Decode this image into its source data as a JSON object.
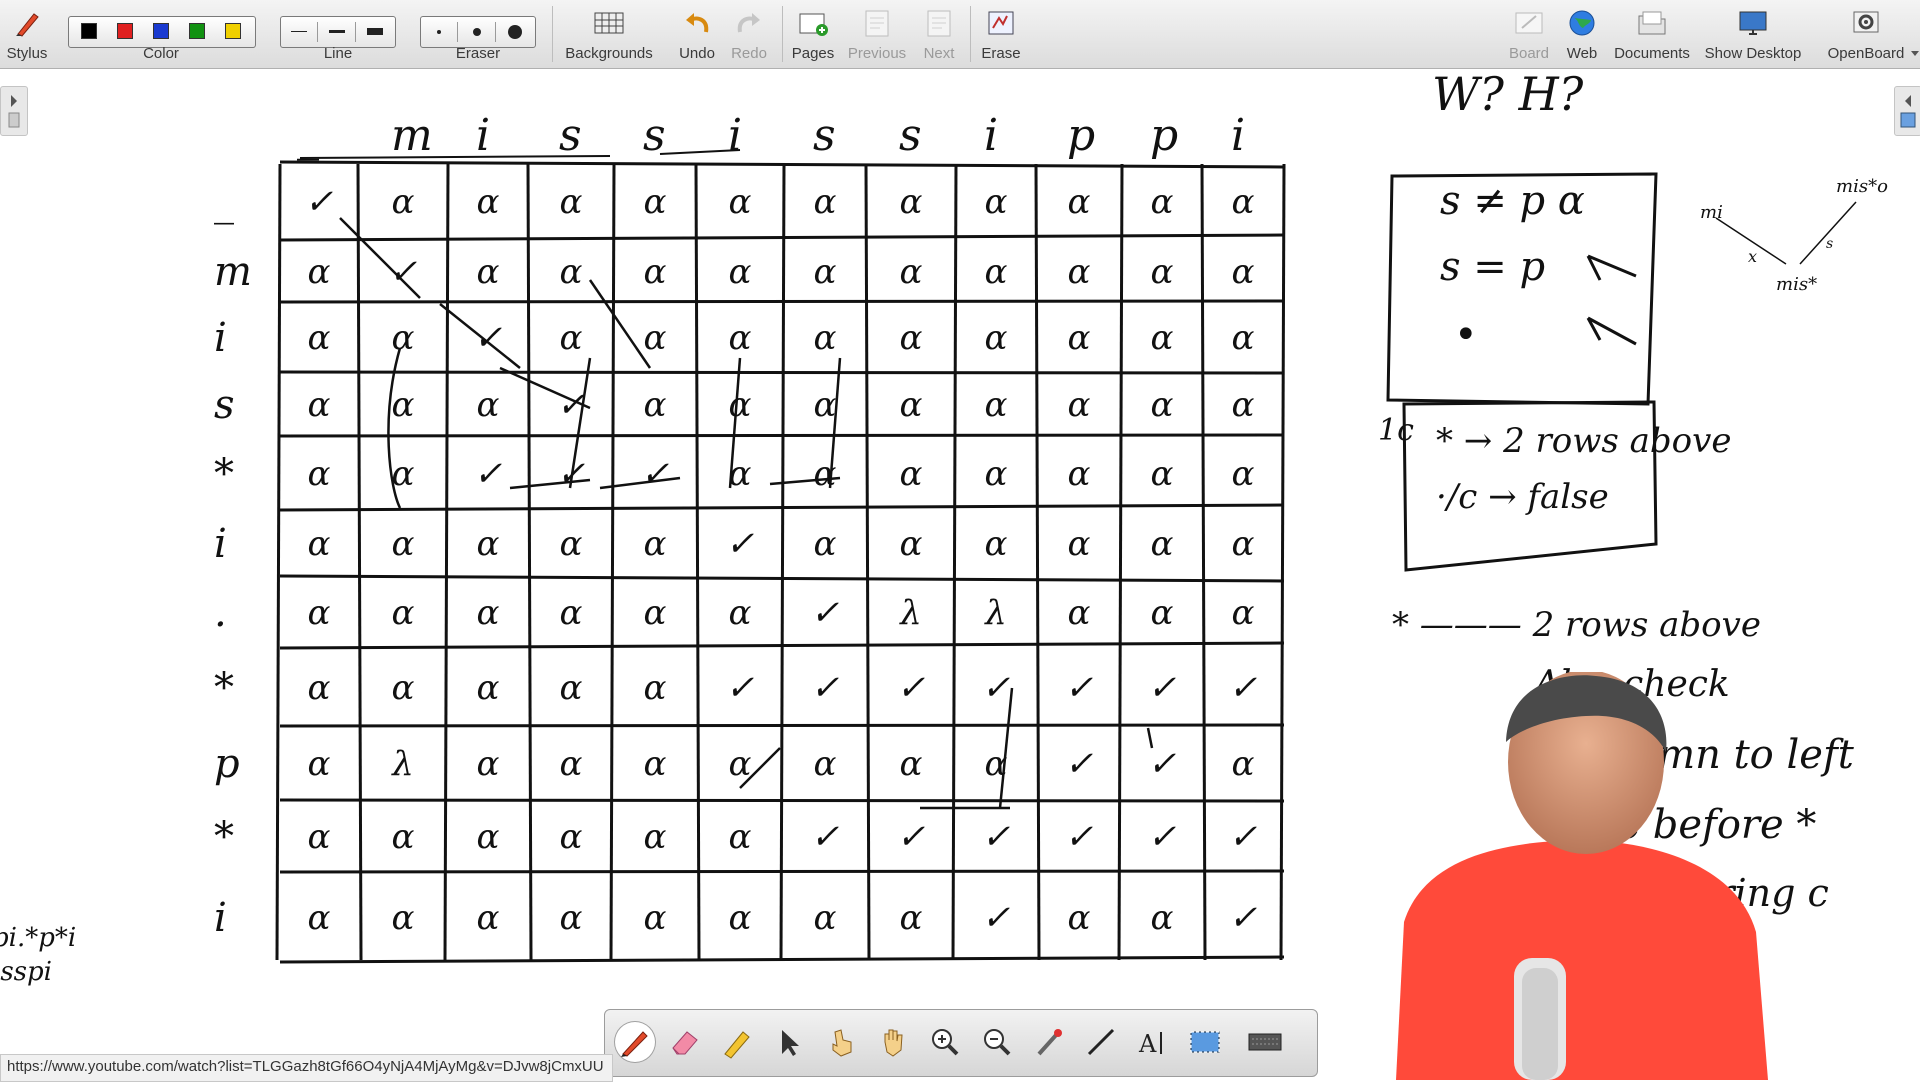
{
  "toolbar": {
    "stylus_label": "Stylus",
    "color_label": "Color",
    "line_label": "Line",
    "eraser_label": "Eraser",
    "backgrounds_label": "Backgrounds",
    "undo_label": "Undo",
    "redo_label": "Redo",
    "pages_label": "Pages",
    "previous_label": "Previous",
    "next_label": "Next",
    "erase_label": "Erase",
    "board_label": "Board",
    "web_label": "Web",
    "documents_label": "Documents",
    "show_desktop_label": "Show Desktop",
    "openboard_label": "OpenBoard",
    "colors": [
      "#000000",
      "#e02020",
      "#1a3ad0",
      "#119211",
      "#f0d000"
    ]
  },
  "board": {
    "header_chars": [
      "_",
      "m",
      "i",
      "s",
      "s",
      "i",
      "s",
      "s",
      "i",
      "p",
      "p",
      "i"
    ],
    "row_chars": [
      "_",
      "m",
      "i",
      "s",
      "*",
      "i",
      ".",
      "*",
      "p",
      "*",
      "i"
    ],
    "grid": [
      [
        "✓",
        "α",
        "α",
        "α",
        "α",
        "α",
        "α",
        "α",
        "α",
        "α",
        "α",
        "α"
      ],
      [
        "α",
        "✓",
        "α",
        "α",
        "α",
        "α",
        "α",
        "α",
        "α",
        "α",
        "α",
        "α"
      ],
      [
        "α",
        "α",
        "✓",
        "α",
        "α",
        "α",
        "α",
        "α",
        "α",
        "α",
        "α",
        "α"
      ],
      [
        "α",
        "α",
        "α",
        "✓",
        "α",
        "α",
        "α",
        "α",
        "α",
        "α",
        "α",
        "α"
      ],
      [
        "α",
        "α",
        "✓",
        "✓",
        "✓",
        "α",
        "α",
        "α",
        "α",
        "α",
        "α",
        "α"
      ],
      [
        "α",
        "α",
        "α",
        "α",
        "α",
        "✓",
        "α",
        "α",
        "α",
        "α",
        "α",
        "α"
      ],
      [
        "α",
        "α",
        "α",
        "α",
        "α",
        "α",
        "✓",
        "λ",
        "λ",
        "α",
        "α",
        "α"
      ],
      [
        "α",
        "α",
        "α",
        "α",
        "α",
        "✓",
        "✓",
        "✓",
        "✓",
        "✓",
        "✓",
        "✓"
      ],
      [
        "α",
        "λ",
        "α",
        "α",
        "α",
        "α",
        "α",
        "α",
        "α",
        "✓",
        "✓",
        "α"
      ],
      [
        "α",
        "α",
        "α",
        "α",
        "α",
        "α",
        "✓",
        "✓",
        "✓",
        "✓",
        "✓",
        "✓"
      ],
      [
        "α",
        "α",
        "α",
        "α",
        "α",
        "α",
        "α",
        "α",
        "✓",
        "α",
        "α",
        "✓"
      ]
    ],
    "notes": {
      "top_question": "W? H?",
      "box_row1": "s ≠ p     α",
      "box_row2": "s = p",
      "box_row3": "•",
      "box_label": "1c",
      "box2_row1": "* → 2 rows above",
      "box2_row2": "·/c → false",
      "note1": "* ——— 2 rows above",
      "note2": "Also check",
      "note3": "1 column to left",
      "note4": "is pc before *",
      "note5": "= last string c",
      "tree_top": "mis*o",
      "tree_left": "mi",
      "tree_bottom": "mis*",
      "tree_x": "x",
      "tree_s": "s",
      "left_margin_1": "pi.*p*i",
      "left_margin_2": "isspi"
    }
  },
  "status": {
    "url": "https://www.youtube.com/watch?list=TLGGazh8tGf66O4yNjA4MjAyMg&v=DJvw8jCmxUU"
  }
}
